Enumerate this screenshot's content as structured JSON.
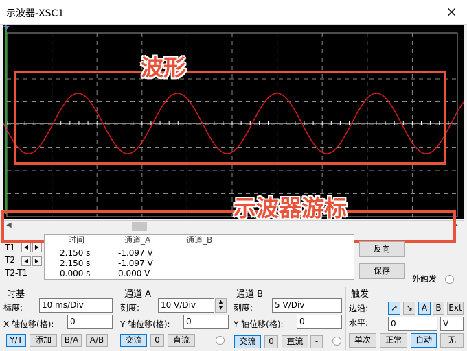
{
  "window": {
    "title": "示波器-XSC1",
    "close_icon": "×"
  },
  "waveform": {
    "trace_color": "#d41c1c",
    "cycles_in_view": 4.625
  },
  "annotations": {
    "waveform": "波形",
    "cursor": "示波器游标"
  },
  "cursors": {
    "t1": "T1",
    "t2": "T2",
    "diff": "T2-T1"
  },
  "readout": {
    "headers": [
      "时间",
      "通道_A",
      "通道_B"
    ],
    "rows": [
      [
        "2.150 s",
        "-1.097 V",
        ""
      ],
      [
        "2.150 s",
        "-1.097 V",
        ""
      ],
      [
        "0.000 s",
        "0.000 V",
        ""
      ]
    ]
  },
  "side_buttons": {
    "reverse": "反向",
    "save": "保存",
    "ext_trigger": "外触发"
  },
  "timebase": {
    "title": "时基",
    "scale_label": "标度:",
    "scale_value": "10 ms/Div",
    "xpos_label": "X 轴位移(格):",
    "xpos_value": "0",
    "buttons": [
      "Y/T",
      "添加",
      "B/A",
      "A/B"
    ]
  },
  "channel_a": {
    "title": "通道 A",
    "scale_label": "刻度:",
    "scale_value": "10  V/Div",
    "ypos_label": "Y 轴位移(格):",
    "ypos_value": "0",
    "buttons": [
      "交流",
      "0",
      "直流"
    ]
  },
  "channel_b": {
    "title": "通道 B",
    "scale_label": "刻度:",
    "scale_value": "5  V/Div",
    "ypos_label": "Y 轴位移(格):",
    "ypos_value": "0",
    "buttons": [
      "交流",
      "0",
      "直流",
      "-"
    ]
  },
  "trigger": {
    "title": "触发",
    "edge_label": "边沿:",
    "edge_buttons": [
      "↗",
      "↘",
      "A",
      "B",
      "Ext"
    ],
    "level_label": "水平:",
    "level_value": "0",
    "level_unit": "V",
    "mode_buttons": [
      "单次",
      "正常",
      "自动",
      "无"
    ]
  }
}
